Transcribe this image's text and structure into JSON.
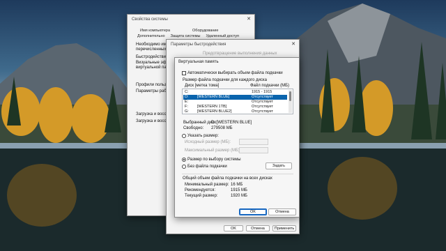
{
  "sysprops": {
    "title": "Свойства системы",
    "tabs": [
      "Имя компьютера",
      "Оборудование",
      "Дополнительно",
      "Защита системы",
      "Удаленный доступ"
    ],
    "lines": [
      "Необходимо иметь п",
      "перечисленных параме",
      "Быстродействие",
      "Визуальные эффект",
      "виртуальной памяти",
      "Профили пользовате",
      "Параметры рабочего",
      "Загрузка и восстан",
      "Загрузка и восстан"
    ]
  },
  "perf": {
    "title": "Параметры быстродействия",
    "buttons": {
      "ok": "OK",
      "cancel": "Отмена",
      "apply": "Применить"
    },
    "hidden_text": "Предотвращение выполнения данных"
  },
  "vm": {
    "title": "Виртуальная память",
    "auto_label": "Автоматически выбирать объем файла подкачки",
    "section_label": "Размер файла подкачки для каждого диска",
    "col_disk": "Диск [метка тома]",
    "col_size": "Файл подкачки (МБ)",
    "drives": [
      {
        "disk": "C:",
        "label": "",
        "size": "1915 - 1915"
      },
      {
        "disk": "D:",
        "label": "[WESTERN BLUE]",
        "size": "Отсутствует"
      },
      {
        "disk": "E:",
        "label": "",
        "size": "Отсутствует"
      },
      {
        "disk": "F:",
        "label": "[WESTERN 1TB]",
        "size": "Отсутствует"
      },
      {
        "disk": "G:",
        "label": "[WESTERN BLUE2]",
        "size": "Отсутствует"
      }
    ],
    "selected_drive_label": "Выбранный диск:",
    "selected_drive_value": "D:  [WESTERN BLUE]",
    "free_label": "Свободно:",
    "free_value": "279508 МБ",
    "custom_label": "Указать размер:",
    "initial_label": "Исходный размер (МБ):",
    "max_label": "Максимальный размер (МБ):",
    "system_label": "Размер по выбору системы",
    "none_label": "Без файла подкачки",
    "set_button": "Задать",
    "total_label": "Общий объем файла подкачки на всех дисках",
    "min_label": "Минимальный размер:",
    "min_value": "16 МБ",
    "rec_label": "Рекомендуется:",
    "rec_value": "1915 МБ",
    "cur_label": "Текущий размер:",
    "cur_value": "1920 МБ",
    "ok": "OK",
    "cancel": "Отмена"
  }
}
